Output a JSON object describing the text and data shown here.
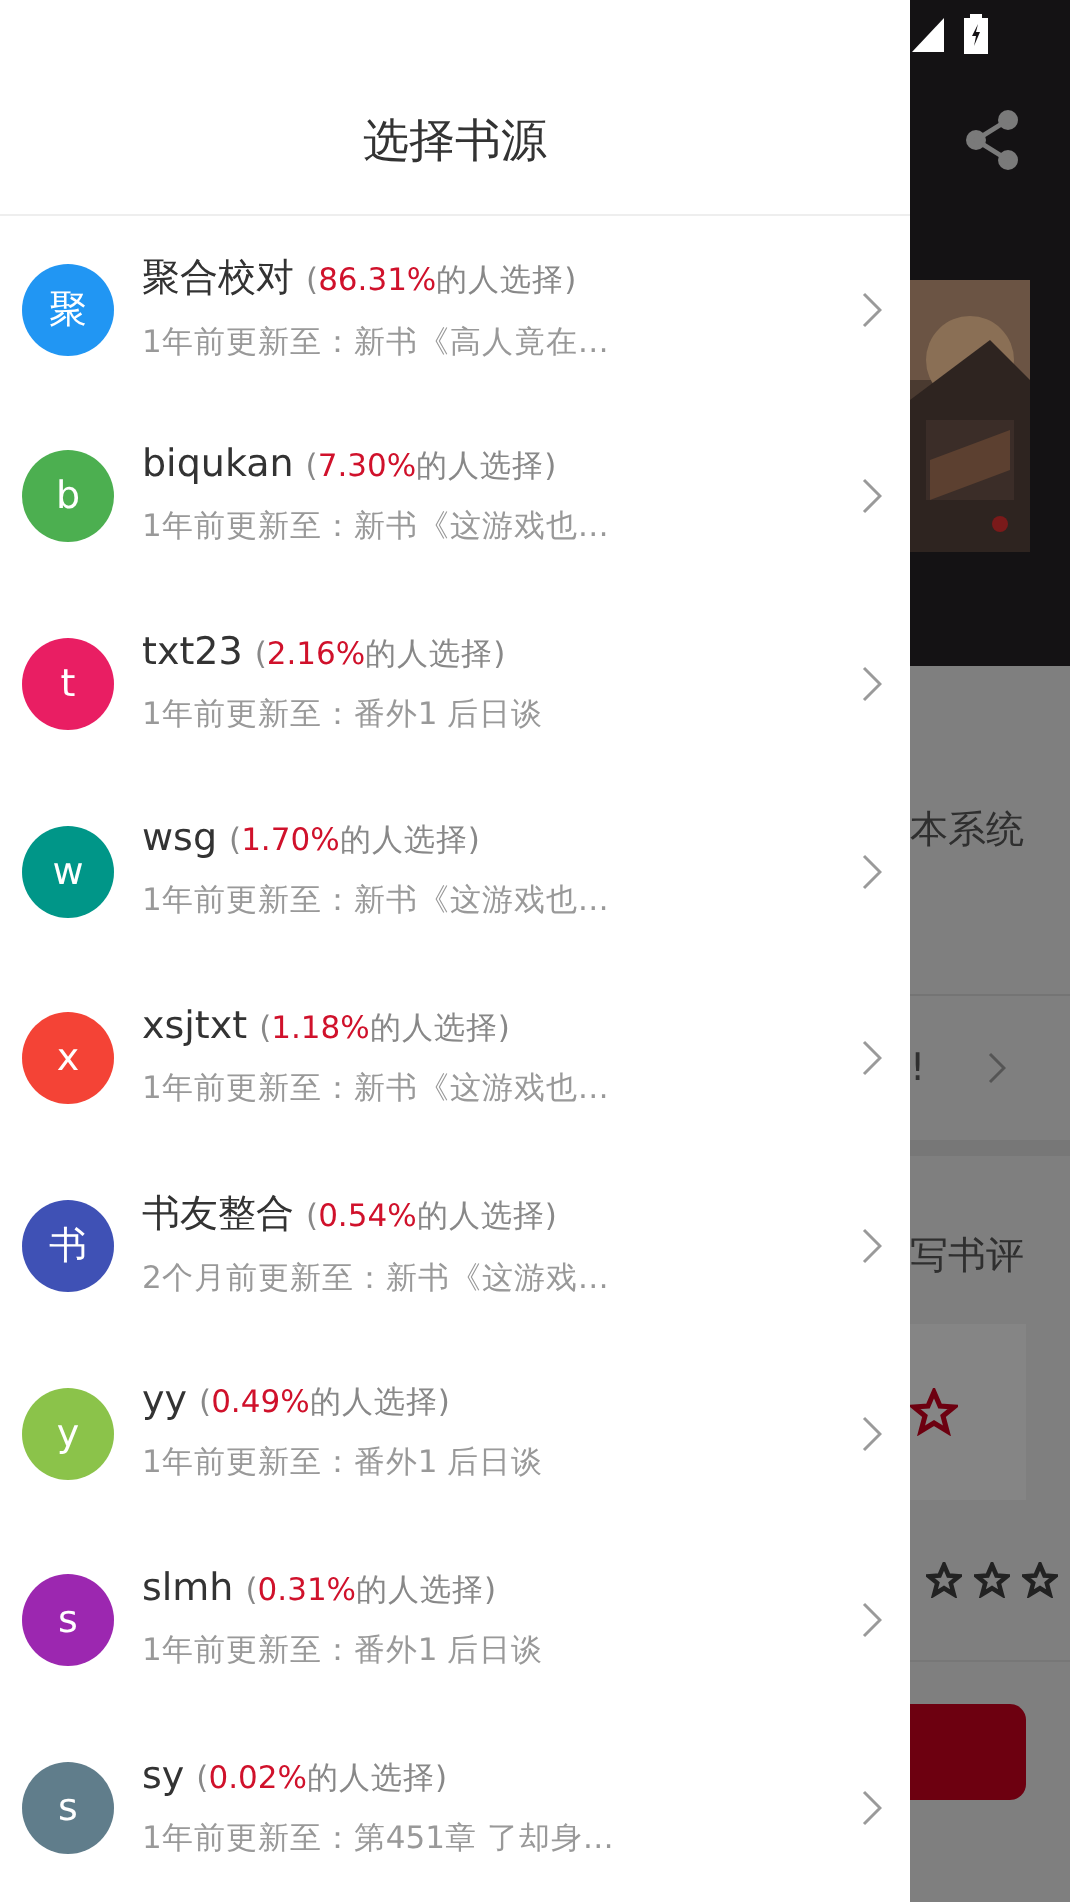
{
  "drawer": {
    "title": "选择书源",
    "sources": [
      {
        "avatar": "聚",
        "color": "#2196f3",
        "name": "聚合校对",
        "open": "(",
        "share": "86.31%",
        "suffix": "的人选择)",
        "update": "1年前更新至：新书《高人竟在…"
      },
      {
        "avatar": "b",
        "color": "#4caf50",
        "name": "biqukan",
        "open": "(",
        "share": "7.30%",
        "suffix": "的人选择)",
        "update": "1年前更新至：新书《这游戏也…"
      },
      {
        "avatar": "t",
        "color": "#e91e63",
        "name": "txt23",
        "open": "(",
        "share": "2.16%",
        "suffix": "的人选择)",
        "update": "1年前更新至：番外1 后日谈"
      },
      {
        "avatar": "w",
        "color": "#009688",
        "name": "wsg",
        "open": "(",
        "share": "1.70%",
        "suffix": "的人选择)",
        "update": "1年前更新至：新书《这游戏也…"
      },
      {
        "avatar": "x",
        "color": "#f44336",
        "name": "xsjtxt",
        "open": "(",
        "share": "1.18%",
        "suffix": "的人选择)",
        "update": "1年前更新至：新书《这游戏也…"
      },
      {
        "avatar": "书",
        "color": "#3f51b5",
        "name": "书友整合",
        "open": "(",
        "share": "0.54%",
        "suffix": "的人选择)",
        "update": "2个月前更新至：新书《这游戏…"
      },
      {
        "avatar": "y",
        "color": "#8bc34a",
        "name": "yy",
        "open": "(",
        "share": "0.49%",
        "suffix": "的人选择)",
        "update": "1年前更新至：番外1 后日谈"
      },
      {
        "avatar": "s",
        "color": "#9c27b0",
        "name": "slmh",
        "open": "(",
        "share": "0.31%",
        "suffix": "的人选择)",
        "update": "1年前更新至：番外1 后日谈"
      },
      {
        "avatar": "s",
        "color": "#607d8b",
        "name": "sy",
        "open": "(",
        "share": "0.02%",
        "suffix": "的人选择)",
        "update": "1年前更新至：第451章 了却身…"
      }
    ]
  },
  "background": {
    "intro_text": "本系统",
    "notice_text": "!",
    "review_label": "写书评"
  }
}
